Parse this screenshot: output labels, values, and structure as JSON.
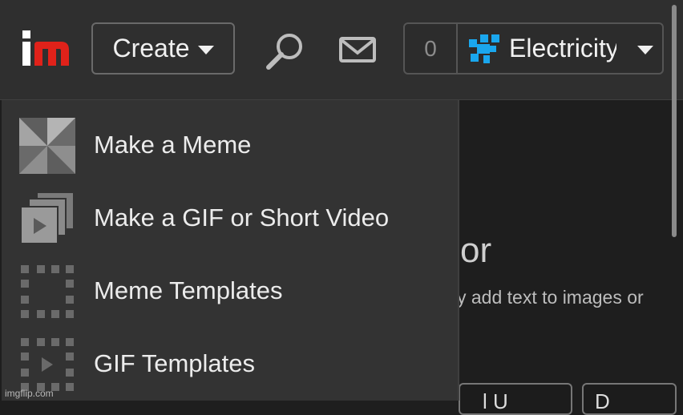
{
  "header": {
    "create_label": "Create",
    "points": "0",
    "username": "Electricity"
  },
  "menu": {
    "items": [
      {
        "label": "Make a Meme",
        "icon": "pinwheel-icon"
      },
      {
        "label": "Make a GIF or Short Video",
        "icon": "stacked-frames-icon"
      },
      {
        "label": "Meme Templates",
        "icon": "dotted-frame-icon"
      },
      {
        "label": "GIF Templates",
        "icon": "dotted-play-frame-icon"
      }
    ]
  },
  "background": {
    "heading_fragment": "or",
    "desc_fragment": "y add text to images or",
    "button_left_fragment": "l U",
    "button_right_fragment": "D"
  },
  "watermark": "imgflip.com",
  "colors": {
    "logo_red": "#e0221a",
    "avatar_blue": "#1aa7ee",
    "header_bg": "#2f2f2f",
    "menu_bg": "#333333"
  }
}
